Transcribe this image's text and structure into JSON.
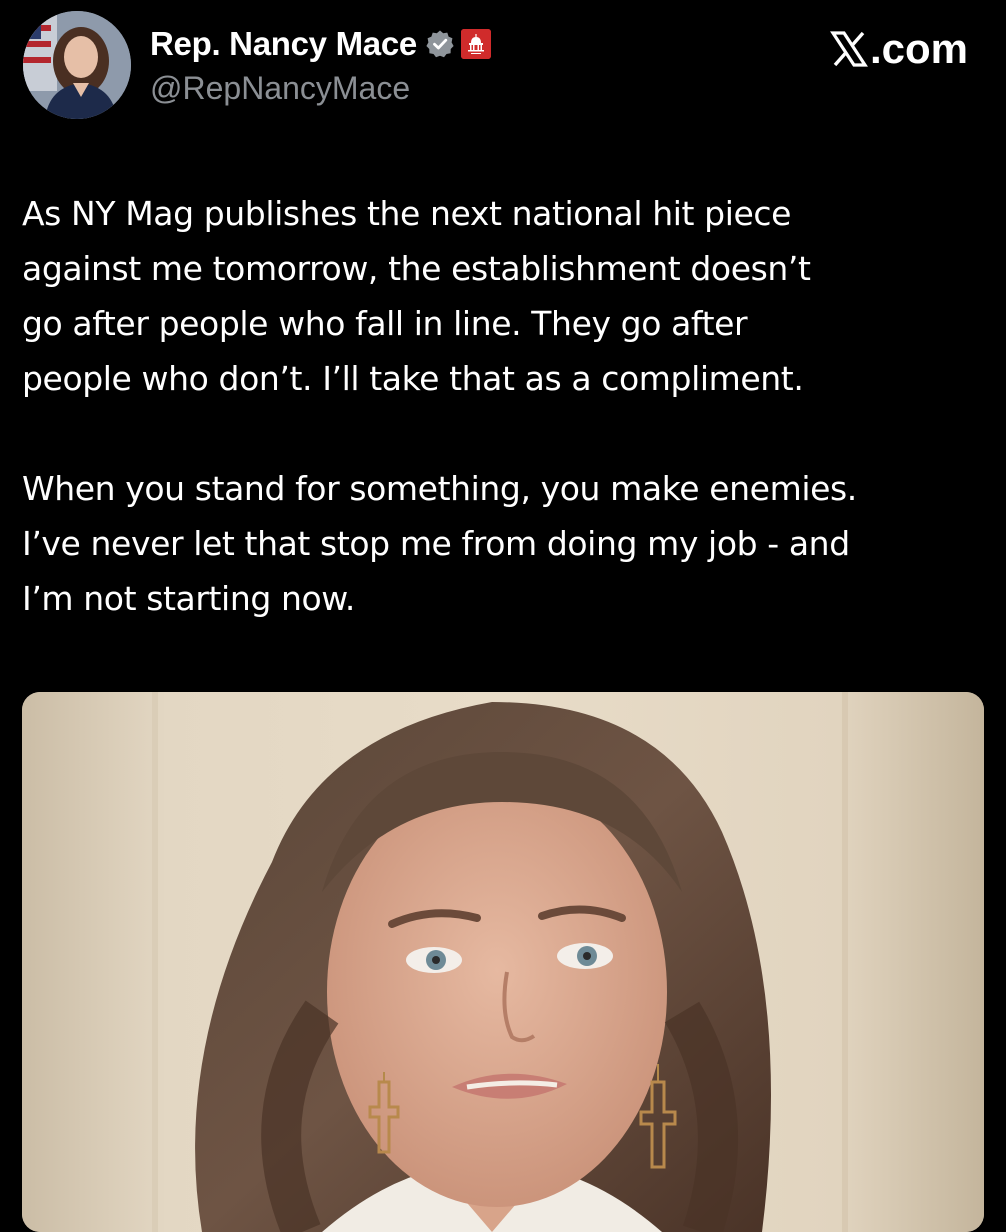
{
  "post": {
    "author": {
      "display_name": "Rep. Nancy Mace",
      "handle": "@RepNancyMace",
      "verified_icon": "verified-badge-icon",
      "affiliation_icon": "capitol-gop-badge-icon"
    },
    "site": {
      "logo_mark": "x-logo-icon",
      "domain_text": ".com"
    },
    "paragraphs": [
      "As NY Mag publishes the next national hit piece\nagainst me tomorrow, the establishment doesn’t\ngo after people who fall in line. They go after\npeople who don’t. I’ll take that as a compliment.",
      "When you stand for something, you make enemies.\nI’ve never let that stop me from doing my job - and\nI’m not starting now."
    ],
    "media": {
      "kind": "video-thumbnail"
    }
  },
  "colors": {
    "background": "#000000",
    "text_primary": "#ffffff",
    "text_secondary": "#8b8f94",
    "verified_badge": "#8f959b",
    "affiliation_badge": "#d02b2b"
  }
}
